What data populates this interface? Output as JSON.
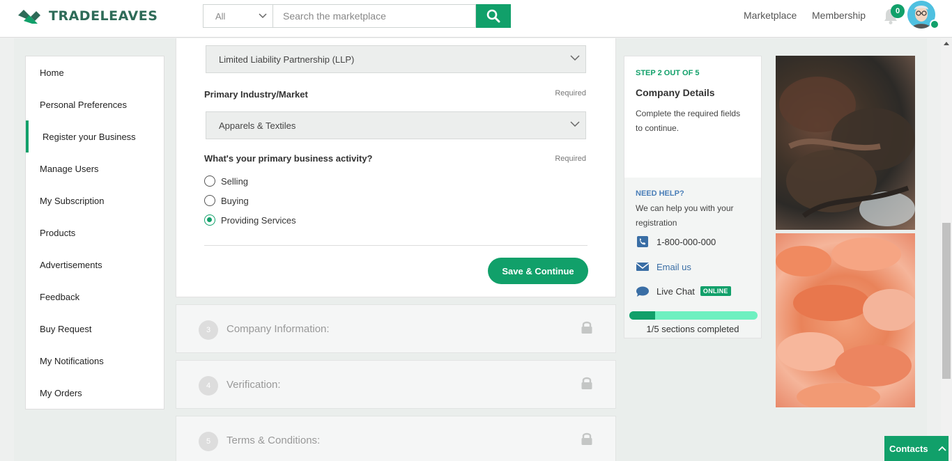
{
  "header": {
    "logo_text": "TRADELEAVES",
    "search_category": "All",
    "search_placeholder": "Search the marketplace",
    "nav_marketplace": "Marketplace",
    "nav_membership": "Membership",
    "notification_count": "0"
  },
  "sidebar": {
    "items": [
      {
        "label": "Home"
      },
      {
        "label": "Personal Preferences"
      },
      {
        "label": "Register your Business"
      },
      {
        "label": "Manage Users"
      },
      {
        "label": "My Subscription"
      },
      {
        "label": "Products"
      },
      {
        "label": "Advertisements"
      },
      {
        "label": "Feedback"
      },
      {
        "label": "Buy Request"
      },
      {
        "label": "My Notifications"
      },
      {
        "label": "My Orders"
      }
    ],
    "active_index": 2
  },
  "form": {
    "business_type_value": "Limited Liability Partnership (LLP)",
    "industry_label": "Primary Industry/Market",
    "industry_required": "Required",
    "industry_value": "Apparels & Textiles",
    "activity_label": "What's your primary business activity?",
    "activity_required": "Required",
    "activity_options": [
      {
        "label": "Selling",
        "selected": false
      },
      {
        "label": "Buying",
        "selected": false
      },
      {
        "label": "Providing Services",
        "selected": true
      }
    ],
    "save_label": "Save & Continue"
  },
  "steps": [
    {
      "number": "3",
      "title": "Company Information:"
    },
    {
      "number": "4",
      "title": "Verification:"
    },
    {
      "number": "5",
      "title": "Terms & Conditions:"
    }
  ],
  "progress": {
    "step_count": "STEP 2 OUT OF 5",
    "title": "Company Details",
    "description": "Complete the required fields to continue.",
    "help_title": "NEED HELP?",
    "help_desc": "We can help you with your registration",
    "phone": "1-800-000-000",
    "email_label": "Email us",
    "chat_label": "Live Chat",
    "chat_status": "ONLINE",
    "sections_completed": 0.2,
    "sections_label": "1/5 sections completed"
  },
  "contacts_tab": "Contacts",
  "colors": {
    "brand": "#11a06a",
    "logo": "#2e6b58",
    "link": "#3a6ea5"
  }
}
